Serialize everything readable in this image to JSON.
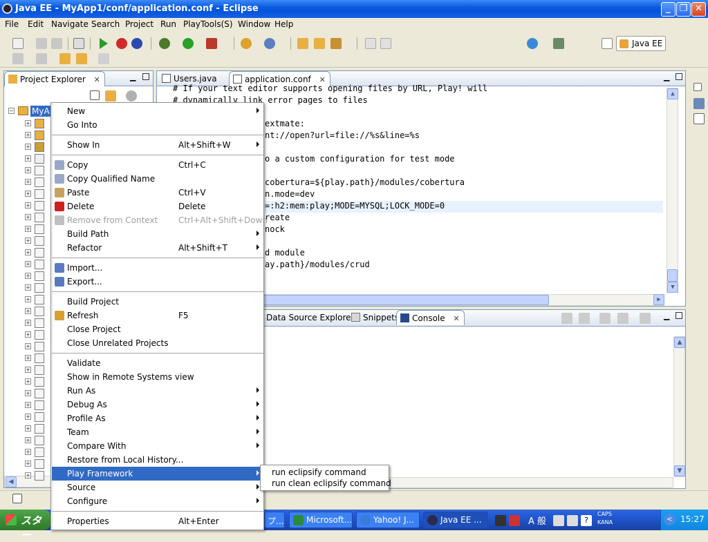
{
  "window": {
    "title": "Java EE - MyApp1/conf/application.conf - Eclipse"
  },
  "menubar": [
    "File",
    "Edit",
    "Navigate",
    "Search",
    "Project",
    "Run",
    "PlayTools(S)",
    "Window",
    "Help"
  ],
  "perspective": {
    "label": "Java EE"
  },
  "project_explorer": {
    "title": "Project Explorer",
    "project_name": "MyA"
  },
  "editor": {
    "tabs": [
      {
        "label": "Users.java",
        "active": false
      },
      {
        "label": "application.conf",
        "active": true
      }
    ],
    "lines": [
      {
        "text": "# If your text editor supports opening files by URL, Play! will",
        "indent": 0
      },
      {
        "text": "# dynamically link error pages to files",
        "indent": 0
      },
      {
        "text": "",
        "indent": 0
      },
      {
        "text": "extmate:",
        "indent": 1
      },
      {
        "text": "nt://open?url=file://%s&line=%s",
        "indent": 1
      },
      {
        "text": "",
        "indent": 0
      },
      {
        "text": "o a custom configuration for test mode",
        "indent": 1
      },
      {
        "text": "",
        "indent": 0
      },
      {
        "text": "cobertura=${play.path}/modules/cobertura",
        "indent": 1
      },
      {
        "text": "n.mode=dev",
        "indent": 1
      },
      {
        "text": "=:h2:mem:play;MODE=MYSQL;LOCK_MODE=0",
        "indent": 1
      },
      {
        "text": "reate",
        "indent": 1
      },
      {
        "text": "nock",
        "indent": 1
      },
      {
        "text": "",
        "indent": 0
      },
      {
        "text": "d module",
        "indent": 1
      },
      {
        "text": "ay.path}/modules/crud",
        "indent": 1
      }
    ]
  },
  "bottom_panel": {
    "tabs": [
      {
        "label": "Data Source Explorer"
      },
      {
        "label": "Snippets"
      },
      {
        "label": "Console"
      }
    ]
  },
  "context_menu": {
    "items": [
      {
        "label": "New",
        "shortcut": "",
        "submenu": true,
        "icon": ""
      },
      {
        "label": "Go Into",
        "shortcut": "",
        "submenu": false,
        "icon": ""
      },
      {
        "sep": true
      },
      {
        "label": "Show In",
        "shortcut": "Alt+Shift+W",
        "submenu": true,
        "icon": ""
      },
      {
        "sep": true
      },
      {
        "label": "Copy",
        "shortcut": "Ctrl+C",
        "submenu": false,
        "icon": "copy-icon"
      },
      {
        "label": "Copy Qualified Name",
        "shortcut": "",
        "submenu": false,
        "icon": "copy-qualified-icon"
      },
      {
        "label": "Paste",
        "shortcut": "Ctrl+V",
        "submenu": false,
        "icon": "paste-icon"
      },
      {
        "label": "Delete",
        "shortcut": "Delete",
        "submenu": false,
        "icon": "delete-icon"
      },
      {
        "label": "Remove from Context",
        "shortcut": "Ctrl+Alt+Shift+Down",
        "submenu": false,
        "icon": "remove-context-icon",
        "disabled": true
      },
      {
        "label": "Build Path",
        "shortcut": "",
        "submenu": true,
        "icon": ""
      },
      {
        "label": "Refactor",
        "shortcut": "Alt+Shift+T",
        "submenu": true,
        "icon": ""
      },
      {
        "sep": true
      },
      {
        "label": "Import...",
        "shortcut": "",
        "submenu": false,
        "icon": "import-icon"
      },
      {
        "label": "Export...",
        "shortcut": "",
        "submenu": false,
        "icon": "export-icon"
      },
      {
        "sep": true
      },
      {
        "label": "Build Project",
        "shortcut": "",
        "submenu": false,
        "icon": ""
      },
      {
        "label": "Refresh",
        "shortcut": "F5",
        "submenu": false,
        "icon": "refresh-icon"
      },
      {
        "label": "Close Project",
        "shortcut": "",
        "submenu": false,
        "icon": ""
      },
      {
        "label": "Close Unrelated Projects",
        "shortcut": "",
        "submenu": false,
        "icon": ""
      },
      {
        "sep": true
      },
      {
        "label": "Validate",
        "shortcut": "",
        "submenu": false,
        "icon": ""
      },
      {
        "label": "Show in Remote Systems view",
        "shortcut": "",
        "submenu": false,
        "icon": ""
      },
      {
        "label": "Run As",
        "shortcut": "",
        "submenu": true,
        "icon": ""
      },
      {
        "label": "Debug As",
        "shortcut": "",
        "submenu": true,
        "icon": ""
      },
      {
        "label": "Profile As",
        "shortcut": "",
        "submenu": true,
        "icon": ""
      },
      {
        "label": "Team",
        "shortcut": "",
        "submenu": true,
        "icon": ""
      },
      {
        "label": "Compare With",
        "shortcut": "",
        "submenu": true,
        "icon": ""
      },
      {
        "label": "Restore from Local History...",
        "shortcut": "",
        "submenu": false,
        "icon": ""
      },
      {
        "label": "Play Framework",
        "shortcut": "",
        "submenu": true,
        "icon": "",
        "selected": true
      },
      {
        "label": "Source",
        "shortcut": "",
        "submenu": true,
        "icon": ""
      },
      {
        "label": "Configure",
        "shortcut": "",
        "submenu": true,
        "icon": ""
      },
      {
        "sep": true
      },
      {
        "label": "Properties",
        "shortcut": "Alt+Enter",
        "submenu": false,
        "icon": ""
      }
    ]
  },
  "submenu": {
    "items": [
      "run eclipsify command",
      "run clean eclipsify command"
    ]
  },
  "taskbar": {
    "start_label": "スター",
    "items": [
      {
        "label": "プ..."
      },
      {
        "label": "Microsoft..."
      },
      {
        "label": "Yahoo! J..."
      },
      {
        "label": "Java EE ..."
      }
    ],
    "ime_label": "A 般",
    "caps_label": "CAPS",
    "kana_label": "KANA",
    "clock": "15:27"
  },
  "colors": {
    "titlebar": "#0a5ae0",
    "menu_selected": "#316ac5",
    "taskbar": "#245edb",
    "start": "#3c8e37"
  }
}
